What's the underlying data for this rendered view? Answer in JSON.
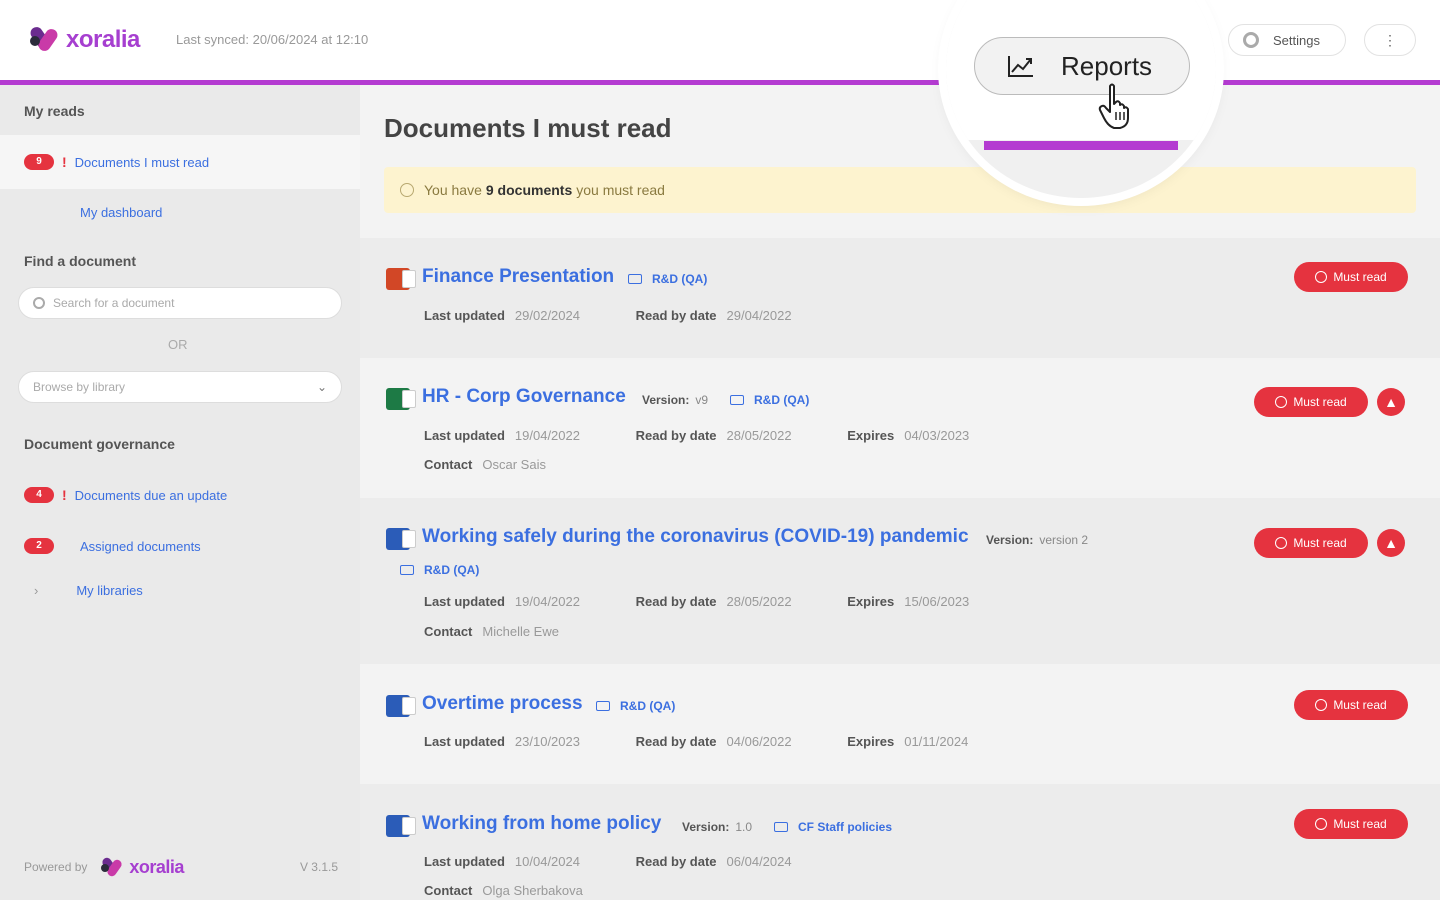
{
  "header": {
    "brand": "xoralia",
    "last_synced": "Last synced: 20/06/2024 at 12:10",
    "settings_label": "Settings",
    "more_label": "⋮",
    "reports_label": "Reports"
  },
  "sidebar": {
    "my_reads_heading": "My reads",
    "must_read": {
      "count": "9",
      "label": "Documents I must read"
    },
    "dashboard_label": "My dashboard",
    "find_heading": "Find a document",
    "search_placeholder": "Search for a document",
    "or_label": "OR",
    "browse_label": "Browse by library",
    "governance_heading": "Document governance",
    "due_update": {
      "count": "4",
      "label": "Documents due an update"
    },
    "assigned": {
      "count": "2",
      "label": "Assigned documents"
    },
    "libraries_label": "My libraries",
    "powered_by": "Powered by",
    "version": "V 3.1.5"
  },
  "main": {
    "title": "Documents I must read",
    "notice": {
      "prefix": "You have",
      "count_text": "9 documents",
      "suffix": "you must read"
    },
    "labels": {
      "last_updated": "Last updated",
      "read_by": "Read by date",
      "expires": "Expires",
      "contact": "Contact",
      "version": "Version:",
      "must_read": "Must read"
    },
    "documents": [
      {
        "title": "Finance Presentation",
        "library": "R&D (QA)",
        "last_updated": "29/02/2024",
        "read_by": "29/04/2022",
        "file_type": "ppt"
      },
      {
        "title": "HR - Corp Governance",
        "version": "v9",
        "library": "R&D (QA)",
        "last_updated": "19/04/2022",
        "read_by": "28/05/2022",
        "expires": "04/03/2023",
        "contact": "Oscar Sais",
        "file_type": "xls"
      },
      {
        "title": "Working safely during the coronavirus (COVID-19) pandemic",
        "version": "version 2",
        "library": "R&D (QA)",
        "last_updated": "19/04/2022",
        "read_by": "28/05/2022",
        "expires": "15/06/2023",
        "contact": "Michelle Ewe",
        "file_type": "doc"
      },
      {
        "title": "Overtime process",
        "library": "R&D (QA)",
        "last_updated": "23/10/2023",
        "read_by": "04/06/2022",
        "expires": "01/11/2024",
        "file_type": "doc"
      },
      {
        "title": "Working from home policy",
        "version": "1.0",
        "library": "CF Staff policies",
        "last_updated": "10/04/2024",
        "read_by": "06/04/2024",
        "contact": "Olga Sherbakova",
        "file_type": "doc"
      }
    ]
  },
  "colors": {
    "accent": "#b43bd1",
    "link": "#3b6fe0",
    "danger": "#e5333f",
    "notice_bg": "#fdf3cf"
  }
}
